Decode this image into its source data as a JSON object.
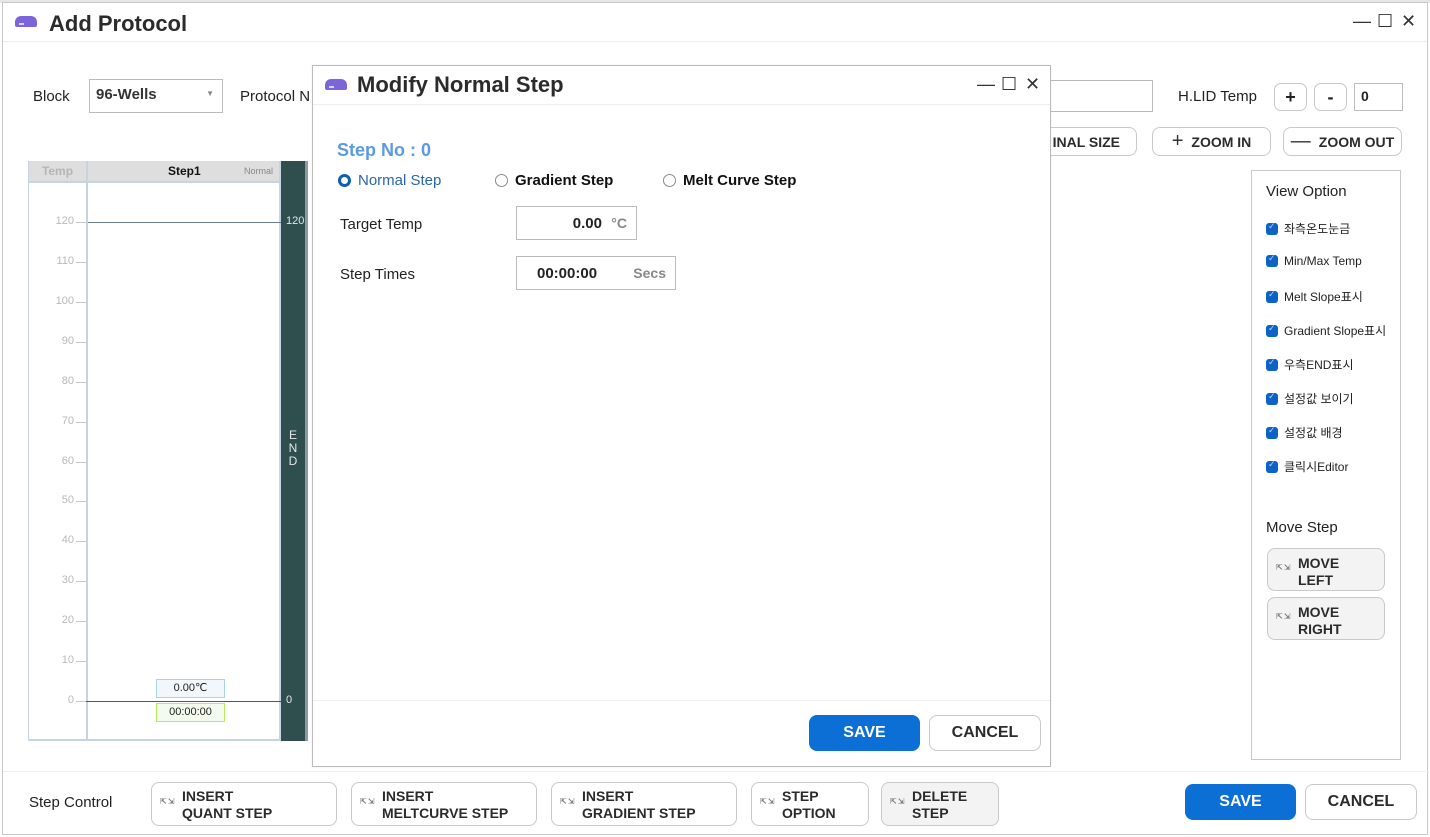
{
  "window": {
    "title": "Add Protocol",
    "icon": "app-icon",
    "controls": {
      "minimize": "—",
      "maximize": "☐",
      "close": "✕"
    }
  },
  "toolbar": {
    "block_label": "Block",
    "block_value": "96-Wells",
    "protocol_name_label": "Protocol N",
    "protocol_name_value": "",
    "hlid_label": "H.LID Temp",
    "hlid_plus": "+",
    "hlid_minus": "-",
    "hlid_value": "0",
    "original_size_label": "INAL SIZE",
    "zoom_in_label": "ZOOM IN",
    "zoom_out_label": "ZOOM OUT",
    "zoom_in_glyph": "+",
    "zoom_out_glyph": "—"
  },
  "chart": {
    "axis_header": "Temp",
    "step_title": "Step1",
    "step_type": "Normal",
    "end_text": [
      "E",
      "N",
      "D"
    ],
    "end_max_label": "120",
    "end_min_label": "0",
    "setpoint_temp": "0.00℃",
    "setpoint_time": "00:00:00"
  },
  "chart_data": {
    "type": "line",
    "title": "",
    "ylabel": "Temp",
    "ylim": [
      0,
      120
    ],
    "yticks": [
      120,
      110,
      100,
      90,
      80,
      70,
      60,
      50,
      40,
      30,
      20,
      10,
      0
    ],
    "categories": [
      "Step1"
    ],
    "series": [
      {
        "name": "Step1 (Normal)",
        "values": [
          0.0
        ]
      }
    ],
    "max_line": 120,
    "min_line": 0,
    "annotations": [
      "0.00℃",
      "00:00:00",
      "END"
    ]
  },
  "view_option": {
    "title": "View Option",
    "items": [
      {
        "label": "좌측온도눈금",
        "checked": true
      },
      {
        "label": "Min/Max Temp",
        "checked": true
      },
      {
        "label": "Melt Slope표시",
        "checked": true
      },
      {
        "label": "Gradient Slope표시",
        "checked": true
      },
      {
        "label": "우측END표시",
        "checked": true
      },
      {
        "label": "설정값 보이기",
        "checked": true
      },
      {
        "label": "설정값 배경",
        "checked": true
      },
      {
        "label": "클릭시Editor",
        "checked": true
      }
    ],
    "move_step_title": "Move Step",
    "move_left": [
      "MOVE",
      "LEFT"
    ],
    "move_right": [
      "MOVE",
      "RIGHT"
    ]
  },
  "step_control": {
    "label": "Step Control",
    "buttons": [
      {
        "line1": "INSERT",
        "line2": "QUANT STEP"
      },
      {
        "line1": "INSERT",
        "line2": "MELTCURVE STEP"
      },
      {
        "line1": "INSERT",
        "line2": "GRADIENT STEP"
      },
      {
        "line1": "STEP",
        "line2": "OPTION"
      },
      {
        "line1": "DELETE",
        "line2": "STEP"
      }
    ],
    "save_label": "SAVE",
    "cancel_label": "CANCEL"
  },
  "modal": {
    "title": "Modify Normal Step",
    "step_no": "Step No : 0",
    "radios": [
      {
        "label": "Normal Step",
        "checked": true
      },
      {
        "label": "Gradient Step",
        "checked": false
      },
      {
        "label": "Melt Curve Step",
        "checked": false
      }
    ],
    "target_temp_label": "Target Temp",
    "target_temp_value": "0.00",
    "target_temp_unit": "°C",
    "step_times_label": "Step Times",
    "step_times_value": "00:00:00",
    "step_times_unit": "Secs",
    "save_label": "SAVE",
    "cancel_label": "CANCEL"
  },
  "colors": {
    "primary": "#0b6fd5",
    "step_no": "#5c9ae6",
    "end_bar": "#2f4f4f",
    "app_icon": "#7a66d8",
    "checkbox": "#0d62c5"
  }
}
